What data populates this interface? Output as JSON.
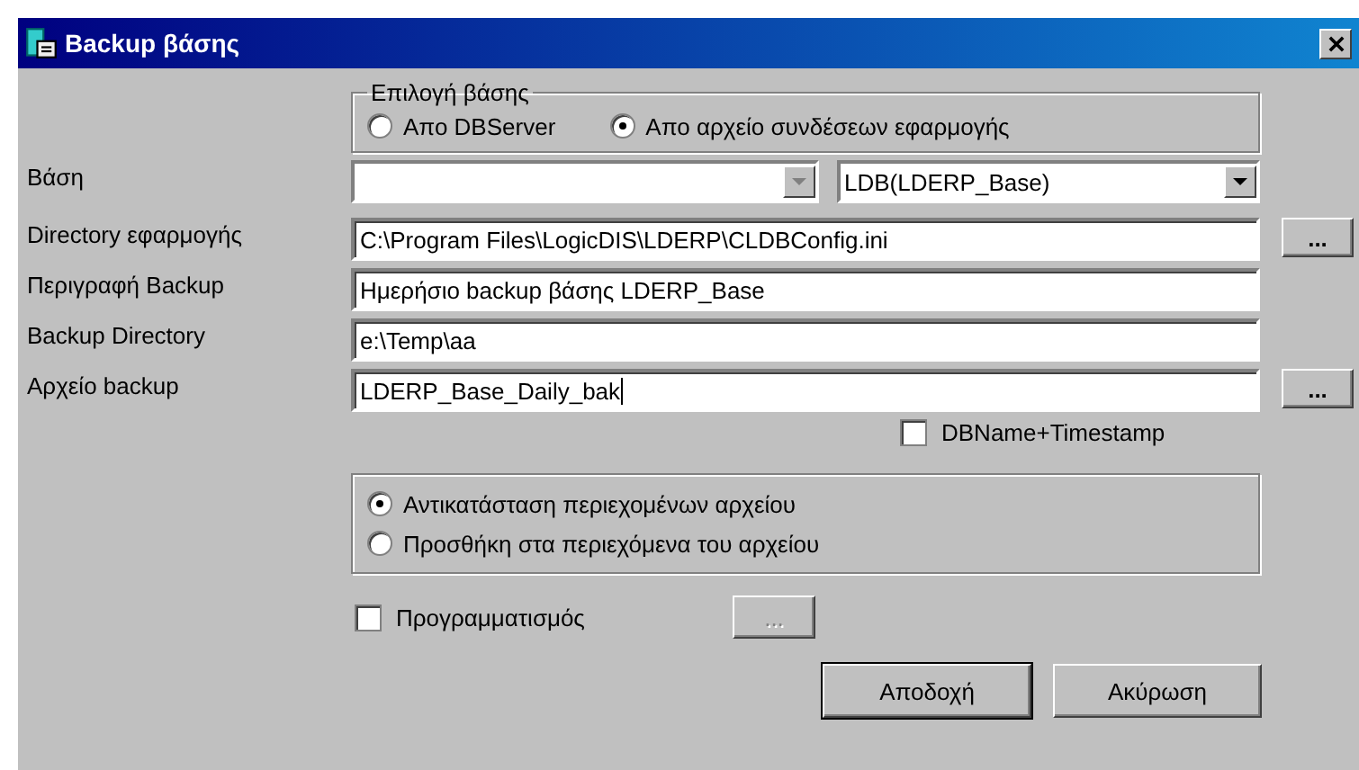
{
  "window": {
    "title": "Backup βάσης"
  },
  "source_group": {
    "legend": "Επιλογή βάσης",
    "options": [
      {
        "label": "Απο DBServer",
        "selected": false
      },
      {
        "label": "Απο αρχείο συνδέσεων εφαρμογής",
        "selected": true
      }
    ]
  },
  "fields": [
    {
      "kind": "combos",
      "label": "Βάση",
      "combos": [
        {
          "disabled": true
        },
        {
          "value": "LDB(LDERP_Base)",
          "disabled": false
        }
      ]
    },
    {
      "kind": "text",
      "label": "Directory εφαρμογής",
      "value": "C:\\Program Files\\LogicDIS\\LDERP\\CLDBConfig.ini",
      "browse": "..."
    },
    {
      "kind": "text",
      "label": "Περιγραφή Backup",
      "value": "Ημερήσιο backup βάσης LDERP_Base"
    },
    {
      "kind": "text",
      "label": "Backup Directory",
      "value": "e:\\Temp\\aa"
    },
    {
      "kind": "text",
      "label": "Αρχείο backup",
      "value": "LDERP_Base_Daily_bak",
      "focused": true,
      "browse": "..."
    }
  ],
  "timestamp_option": {
    "label": "DBName+Timestamp",
    "checked": false
  },
  "mode_group": {
    "options": [
      {
        "label": "Αντικατάσταση περιεχομένων αρχείου",
        "selected": true
      },
      {
        "label": "Προσθήκη στα περιεχόμενα του αρχείου",
        "selected": false
      }
    ]
  },
  "schedule": {
    "label": "Προγραμματισμός",
    "checked": false,
    "button": {
      "label": "...",
      "disabled": true
    }
  },
  "buttons": [
    {
      "label": "Αποδοχή",
      "default": true
    },
    {
      "label": "Ακύρωση",
      "default": false
    }
  ]
}
